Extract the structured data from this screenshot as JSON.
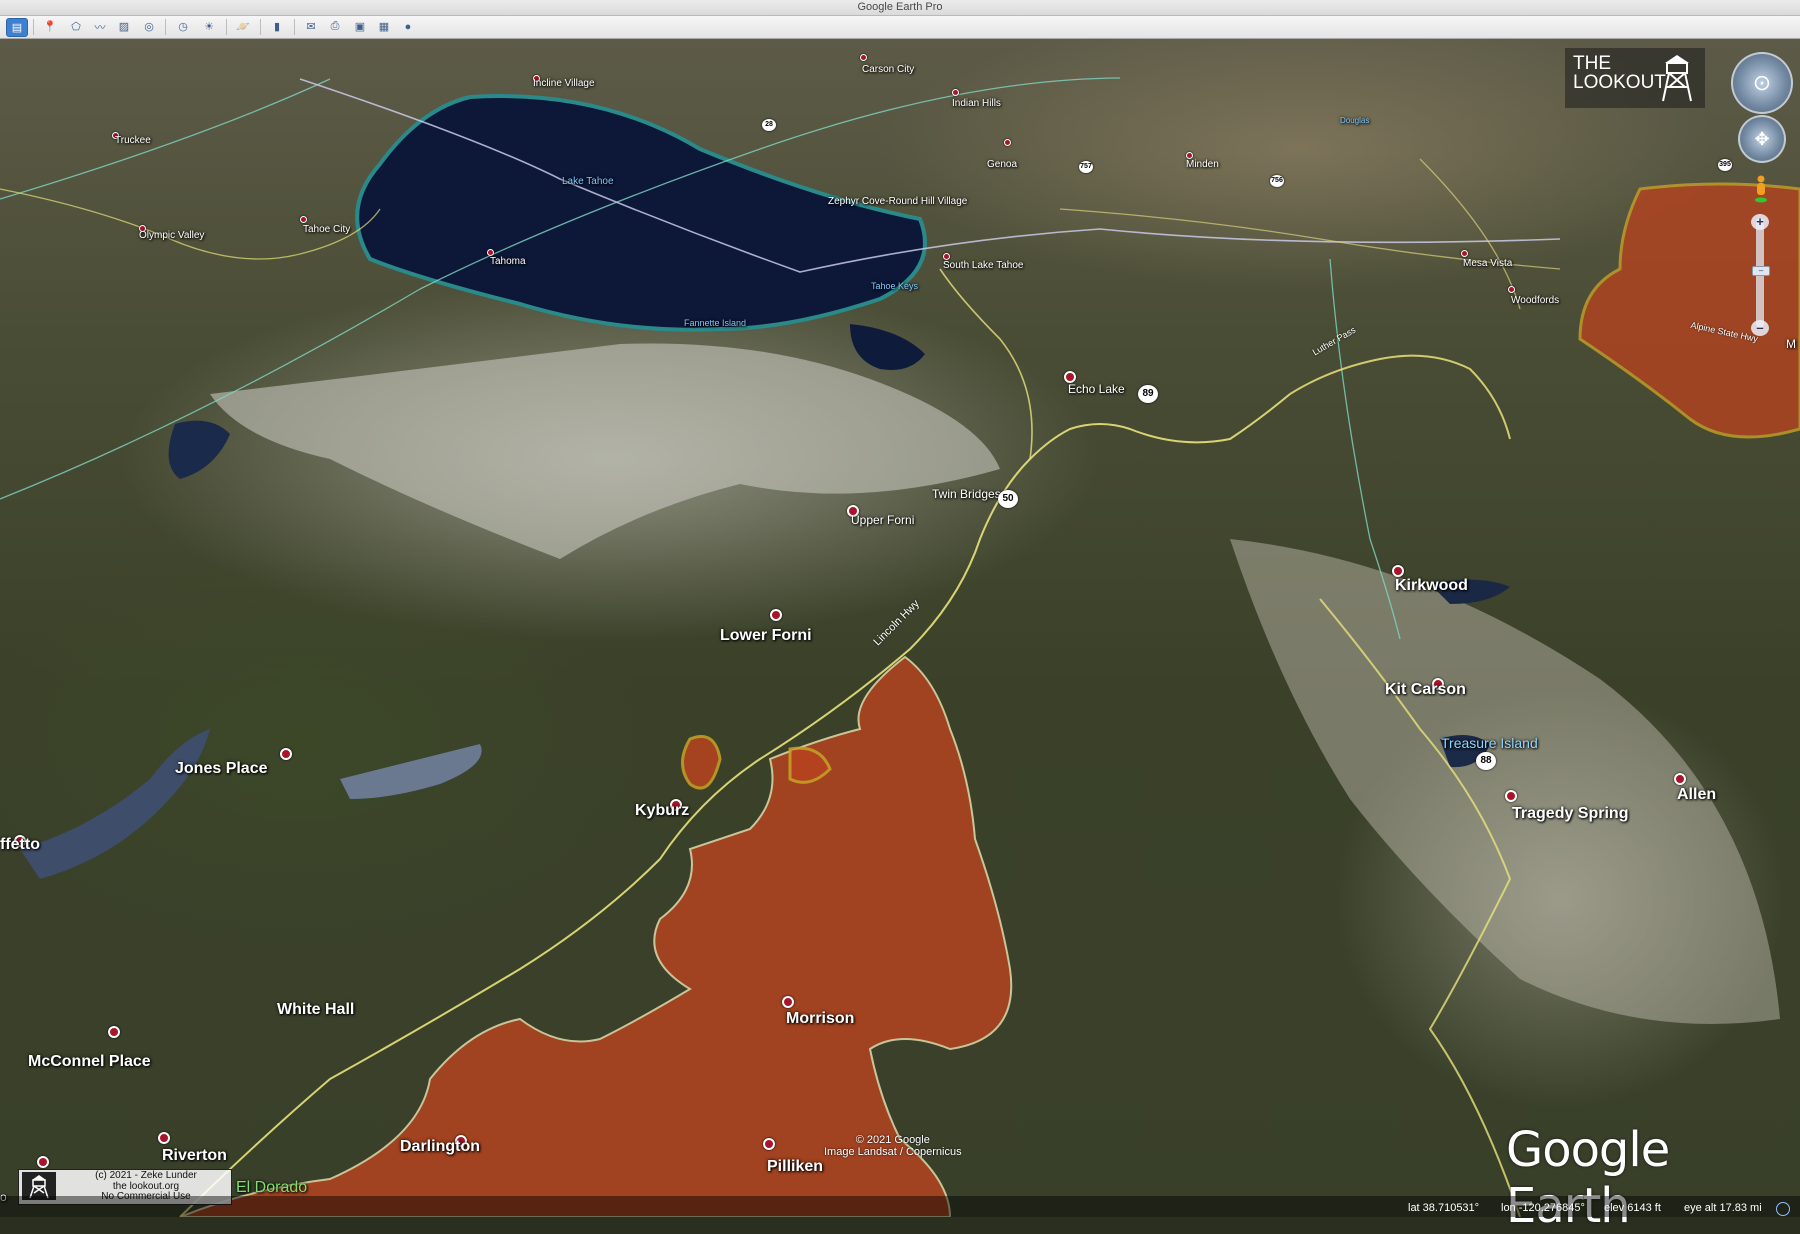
{
  "window": {
    "title": "Google Earth Pro"
  },
  "toolbar": {
    "icons": [
      "sidebar-icon",
      "placemark-icon",
      "polygon-icon",
      "path-icon",
      "image-overlay-icon",
      "tour-icon",
      "history-icon",
      "sun-icon",
      "planets-icon",
      "ruler-icon",
      "email-icon",
      "print-icon",
      "save-image-icon",
      "movie-icon",
      "maps-icon"
    ]
  },
  "map": {
    "places": {
      "incline_village": "Incline Village",
      "carson_city": "Carson City",
      "indian_hills": "Indian Hills",
      "truckee": "Truckee",
      "douglas": "Douglas",
      "genoa": "Genoa",
      "minden": "Minden",
      "lake_tahoe": "Lake Tahoe",
      "zephyr_cove": "Zephyr Cove-Round Hill Village",
      "olympic_valley": "Olympic Valley",
      "tahoe_city": "Tahoe City",
      "tahoma": "Tahoma",
      "south_lake_tahoe": "South Lake Tahoe",
      "tahoe_keys": "Tahoe Keys",
      "fannette_island": "Fannette Island",
      "mesa_vista": "Mesa Vista",
      "woodfords": "Woodfords",
      "echo_lake": "Echo Lake",
      "twin_bridges": "Twin Bridges",
      "upper_forni": "Upper Forni",
      "kirkwood": "Kirkwood",
      "lower_forni": "Lower Forni",
      "kit_carson": "Kit Carson",
      "treasure_island": "Treasure Island",
      "jones_place": "Jones Place",
      "allen": "Allen",
      "kyburz": "Kyburz",
      "tragedy_spring": "Tragedy Spring",
      "ffetto": "ffetto",
      "white_hall": "White Hall",
      "morrison": "Morrison",
      "mcconnel_place": "McConnel Place",
      "riverton": "Riverton",
      "darlington": "Darlington",
      "pilliken": "Pilliken",
      "el_dorado": "El Dorado",
      "edge_m": "M",
      "edge_o": "o"
    },
    "roads": {
      "lincoln_hwy": "Lincoln Hwy",
      "alpine_state_hwy": "Alpine State Hwy",
      "luther_pass": "Luther Pass"
    },
    "shields": {
      "hwy_89": "89",
      "hwy_50": "50",
      "hwy_88": "88",
      "hwy_395": "395",
      "hwy_28": "28",
      "hwy_757": "757",
      "hwy_756": "756"
    },
    "fire_color": "#b8431f",
    "fire_edge_color": "#c8a325"
  },
  "overlay": {
    "brand_line1": "THE",
    "brand_line2": "LOOKOUT",
    "copyright_line1": "© 2021 Google",
    "copyright_line2": "Image Landsat / Copernicus",
    "logo": "Google Earth",
    "credit_line1": "(c) 2021 - Zeke Lunder",
    "credit_line2": "the lookout.org",
    "credit_line3": "No Commercial Use"
  },
  "status": {
    "lat": "lat  38.710531°",
    "lon": "lon -120.276845°",
    "elev": "elev  6143 ft",
    "eye_alt": "eye alt  17.83 mi"
  }
}
